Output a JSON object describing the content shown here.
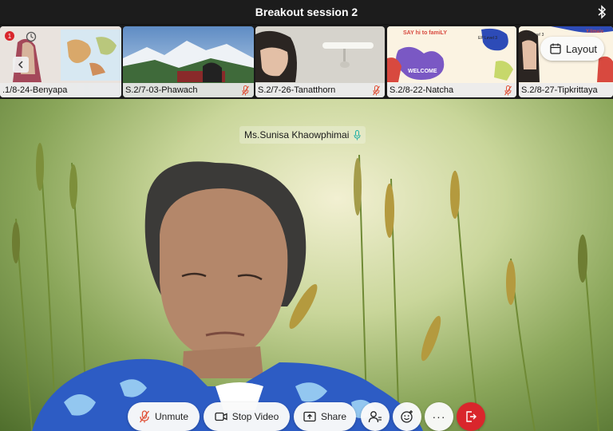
{
  "window": {
    "title": "Breakout session 2"
  },
  "gallery": {
    "tiles": [
      {
        "label": ".1/8-24-Benyapa"
      },
      {
        "label": "S.2/7-03-Phawach"
      },
      {
        "label": "S.2/7-26-Tanatthorn"
      },
      {
        "label": "S.2/8-22-Natcha"
      },
      {
        "label": "S.2/8-27-Tipkrittaya"
      }
    ],
    "recording_badge": "1",
    "slide_text": {
      "headline": "SAY hi to famiLY",
      "level": "EP Level 3",
      "welcome": "WELCOME",
      "level_short": "E leve! 3",
      "fragment": "Y.lima!c"
    }
  },
  "layout_button": {
    "label": "Layout"
  },
  "main_video": {
    "speaker_name": "Ms.Sunisa Khaowphimai"
  },
  "toolbar": {
    "unmute_label": "Unmute",
    "stop_video_label": "Stop Video",
    "share_label": "Share",
    "more_label": "···"
  },
  "colors": {
    "leave_red": "#d9262c",
    "mic_muted": "#e0533a",
    "mic_active": "#29b3a7"
  }
}
